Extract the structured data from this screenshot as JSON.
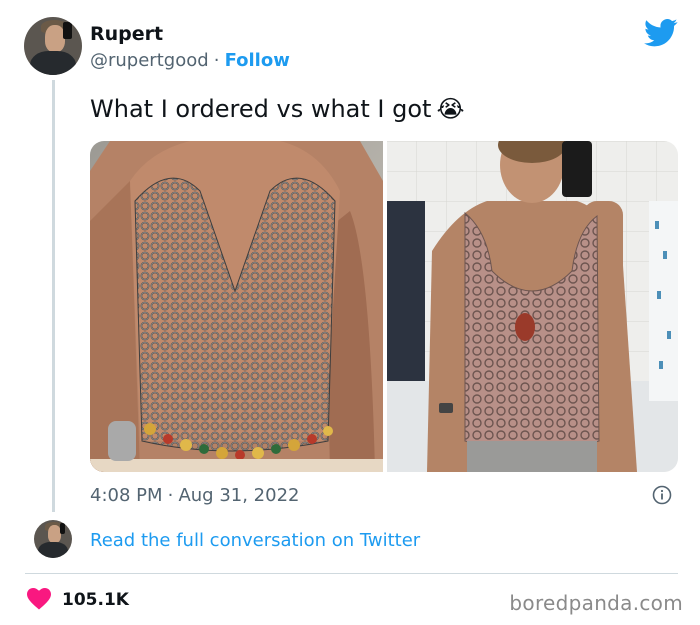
{
  "author": {
    "name": "Rupert",
    "handle": "@rupertgood",
    "separator": "·",
    "follow_label": "Follow"
  },
  "tweet": {
    "text": "What I ordered vs what I got",
    "emoji": "😭",
    "time": "4:08 PM",
    "dot": "·",
    "date": "Aug 31, 2022"
  },
  "read_more": "Read the full conversation on Twitter",
  "likes": "105.1K",
  "credit": "boredpanda.com",
  "icons": {
    "brand": "twitter-bird-icon",
    "info": "info-icon",
    "like": "heart-icon"
  },
  "colors": {
    "accent": "#1d9bf0",
    "heart": "#f91880",
    "text": "#0f1419",
    "muted": "#536471"
  }
}
